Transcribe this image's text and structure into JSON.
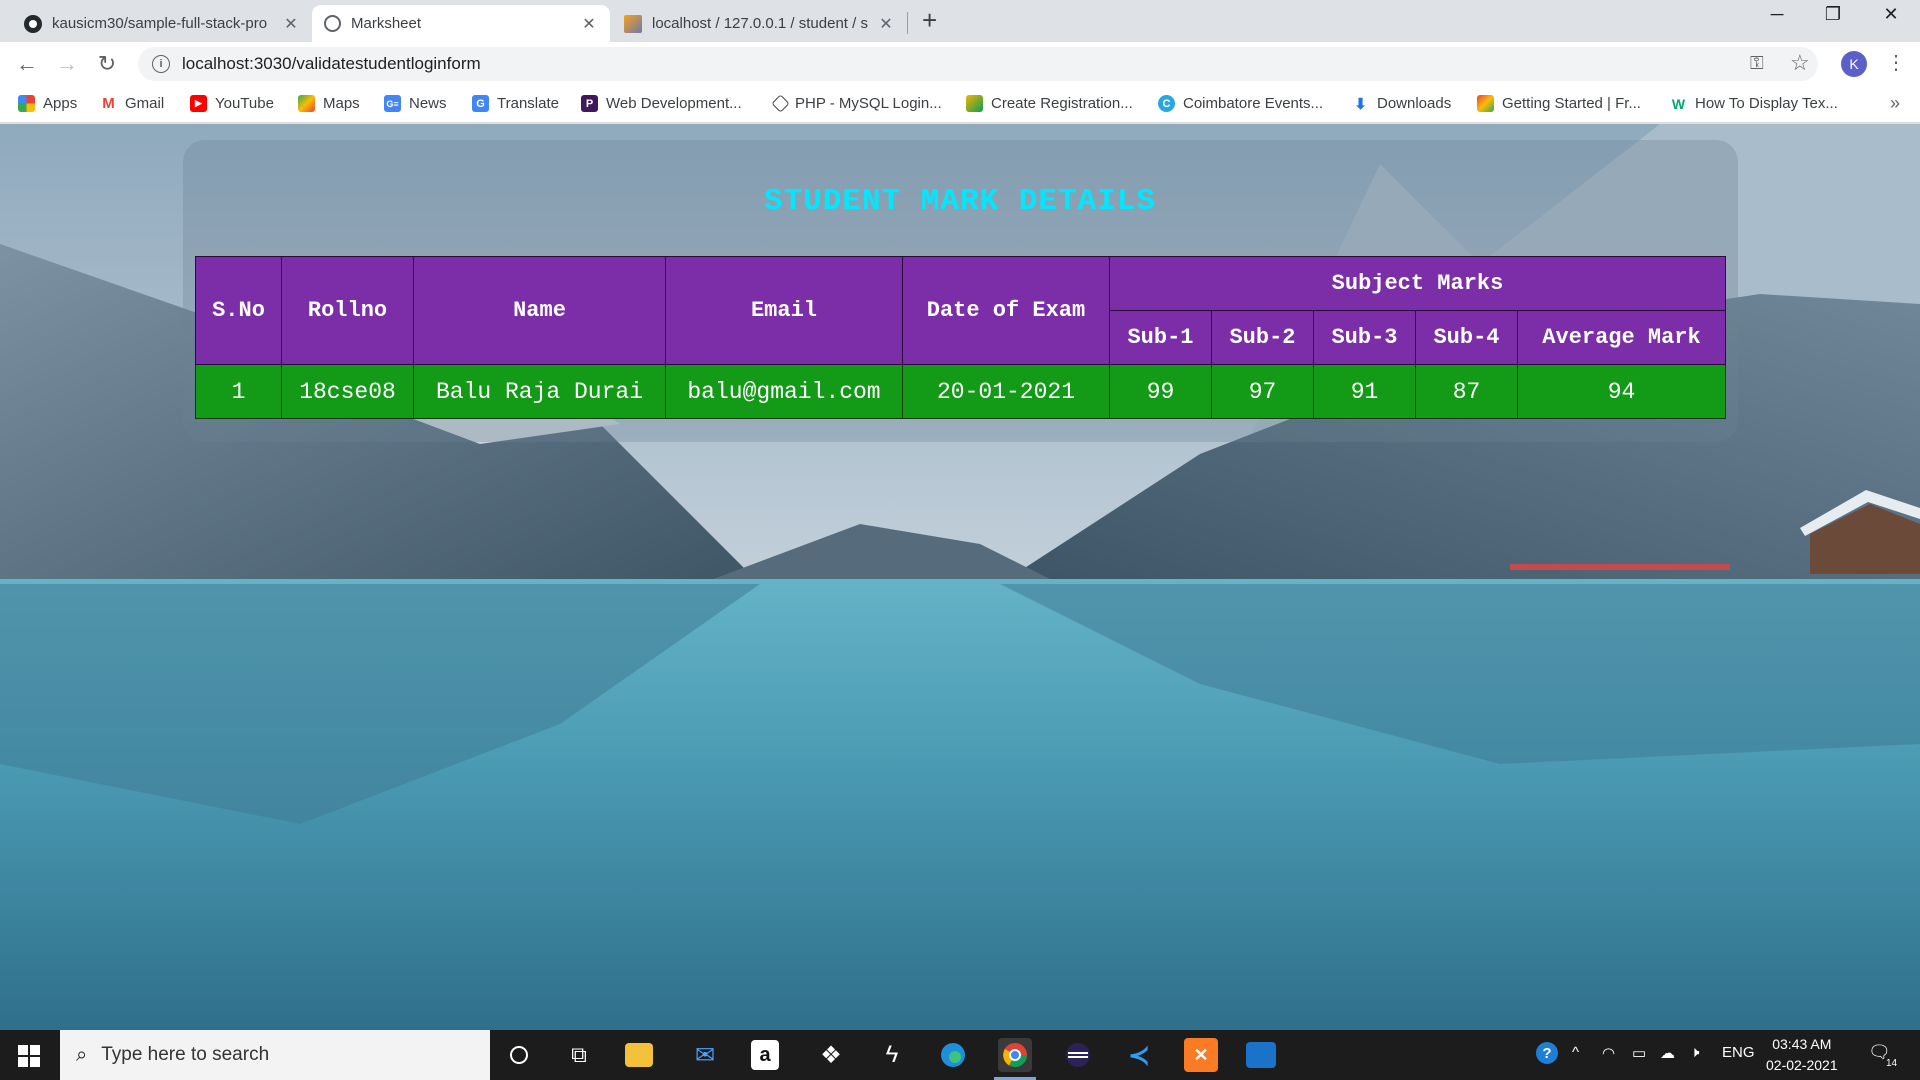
{
  "browser": {
    "tabs": [
      {
        "title": "kausicm30/sample-full-stack-pro",
        "icon": "github-icon"
      },
      {
        "title": "Marksheet",
        "icon": "globe-icon"
      },
      {
        "title": "localhost / 127.0.0.1 / student / s",
        "icon": "phpmyadmin-icon"
      }
    ],
    "url": "localhost:3030/validatestudentloginform",
    "profile_initial": "K"
  },
  "bookmarks": [
    {
      "label": "Apps",
      "icon": "apps-grid-icon"
    },
    {
      "label": "Gmail",
      "icon": "gmail-icon"
    },
    {
      "label": "YouTube",
      "icon": "youtube-icon"
    },
    {
      "label": "Maps",
      "icon": "maps-icon"
    },
    {
      "label": "News",
      "icon": "news-icon"
    },
    {
      "label": "Translate",
      "icon": "translate-icon"
    },
    {
      "label": "Web Development...",
      "icon": "webdev-icon"
    },
    {
      "label": "PHP - MySQL Login...",
      "icon": "php-icon"
    },
    {
      "label": "Create Registration...",
      "icon": "registration-icon"
    },
    {
      "label": "Coimbatore Events...",
      "icon": "events-icon"
    },
    {
      "label": "Downloads",
      "icon": "download-icon"
    },
    {
      "label": "Getting Started | Fr...",
      "icon": "getting-started-icon"
    },
    {
      "label": "How To Display Tex...",
      "icon": "w3schools-icon"
    }
  ],
  "page": {
    "title": "STUDENT MARK DETAILS",
    "headers": {
      "sno": "S.No",
      "rollno": "Rollno",
      "name": "Name",
      "email": "Email",
      "date": "Date of Exam",
      "subject_marks": "Subject Marks",
      "sub1": "Sub-1",
      "sub2": "Sub-2",
      "sub3": "Sub-3",
      "sub4": "Sub-4",
      "average": "Average Mark"
    },
    "rows": [
      {
        "sno": "1",
        "rollno": "18cse08",
        "name": "Balu Raja Durai",
        "email": "balu@gmail.com",
        "date": "20-01-2021",
        "sub1": "99",
        "sub2": "97",
        "sub3": "91",
        "sub4": "87",
        "average": "94"
      }
    ]
  },
  "taskbar": {
    "search_placeholder": "Type here to search",
    "language": "ENG",
    "time": "03:43 AM",
    "date": "02-02-2021",
    "notification_count": "14"
  }
}
